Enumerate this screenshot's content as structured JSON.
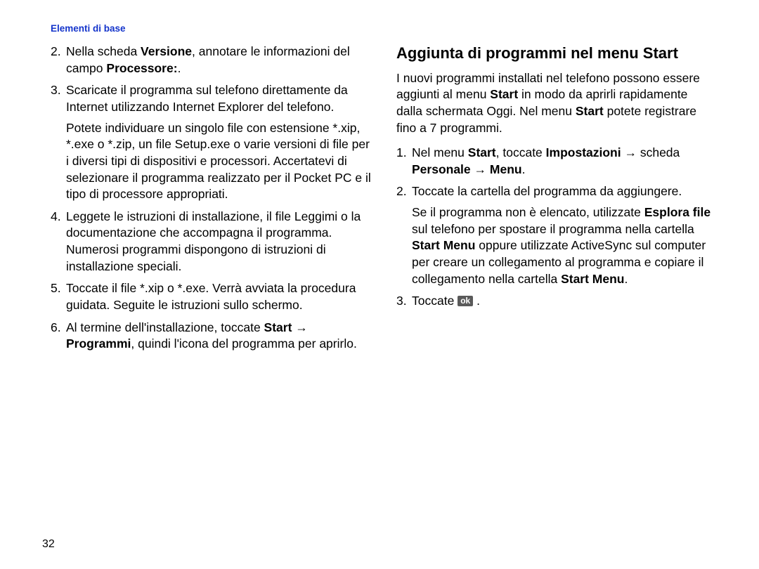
{
  "header": "Elementi di base",
  "pageNumber": "32",
  "left": {
    "items": [
      {
        "n": "2.",
        "html": "Nella scheda <b>Versione</b>, annotare le informazioni del campo <b>Processore:</b>."
      },
      {
        "n": "3.",
        "html": "Scaricate il programma sul telefono direttamente da Internet utilizzando Internet Explorer del telefono.",
        "sub": "Potete individuare un singolo file con estensione *.xip, *.exe o *.zip, un file Setup.exe o varie versioni di file per i diversi tipi di dispositivi e processori. Accertatevi di selezionare il programma realizzato per il Pocket PC e il tipo di processore appropriati."
      },
      {
        "n": "4.",
        "html": "Leggete le istruzioni di installazione, il file Leggimi o la documentazione che accompagna il programma. Numerosi programmi dispongono di istruzioni di installazione speciali."
      },
      {
        "n": "5.",
        "html": "Toccate il file *.xip o *.exe. Verrà avviata la procedura guidata. Seguite le istruzioni sullo schermo."
      },
      {
        "n": "6.",
        "html": "Al termine dell'installazione, toccate <b>Start</b> → <b>Programmi</b>, quindi l'icona del programma per aprirlo."
      }
    ]
  },
  "right": {
    "heading": "Aggiunta di programmi nel menu Start",
    "intro": "I nuovi programmi installati nel telefono possono essere aggiunti al menu <b>Start</b> in modo da aprirli rapidamente dalla schermata Oggi. Nel menu <b>Start</b> potete registrare fino a 7 programmi.",
    "items": [
      {
        "n": "1.",
        "html": "Nel menu <b>Start</b>, toccate <b>Impostazioni</b> → scheda <b>Personale</b> → <b>Menu</b>."
      },
      {
        "n": "2.",
        "html": "Toccate la cartella del programma da aggiungere.",
        "sub": "Se il programma non è elencato, utilizzate <b>Esplora file</b> sul telefono per spostare il programma nella cartella <b>Start Menu</b> oppure utilizzate ActiveSync sul computer per creare un collegamento al programma e copiare il collegamento nella cartella <b>Start Menu</b>."
      },
      {
        "n": "3.",
        "html": "Toccate <span class=\"ok\">ok</span> ."
      }
    ]
  }
}
